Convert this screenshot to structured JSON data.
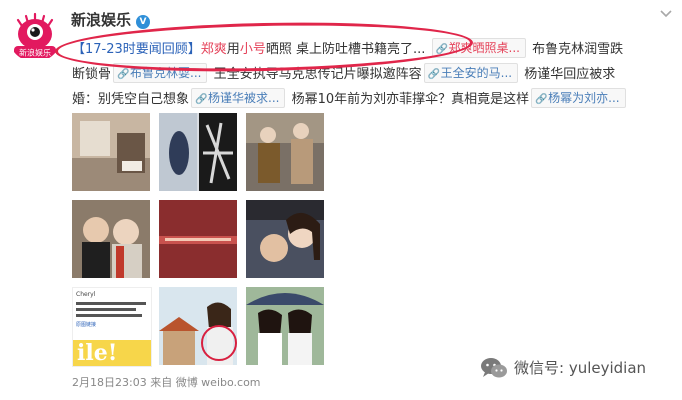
{
  "account": {
    "name": "新浪娱乐",
    "avatar_label": "新浪娱乐",
    "verified_glyph": "V"
  },
  "header_menu_icon": "chevron-down-icon",
  "post": {
    "line1": {
      "bracket": "【17-23时要闻回顾】",
      "name1": "郑爽",
      "text1": "用",
      "name2": "小号",
      "text2": "晒照 桌上防吐槽书籍亮了",
      "ellipsis": "...",
      "tag1": "郑爽晒照桌...",
      "tail": "布鲁克林润雪跌"
    },
    "line2": {
      "text1": "断锁骨",
      "tag2": "布鲁克林耍...",
      "text2": "王全安执导马克思传记片曝拟邀阵容",
      "tag3": "王全安的马...",
      "text3": "杨谨华回应被求"
    },
    "line3": {
      "text1": "婚：别凭空自己想象",
      "tag4": "杨谨华被求...",
      "text2": "杨幂10年前为刘亦菲撑伞？真相竟是这样",
      "tag5": "杨幂为刘亦..."
    }
  },
  "images": [
    {
      "label": "thumb-1"
    },
    {
      "label": "thumb-2"
    },
    {
      "label": "thumb-3"
    },
    {
      "label": "thumb-4"
    },
    {
      "label": "thumb-5"
    },
    {
      "label": "thumb-6"
    },
    {
      "label": "thumb-7"
    },
    {
      "label": "thumb-8"
    },
    {
      "label": "thumb-9"
    }
  ],
  "thumb_text": {
    "sign": "ile!",
    "note_header": "Cheryl",
    "note_link": "原图链接"
  },
  "footer": {
    "time_source": "2月18日23:03 来自 微博 weibo.com"
  },
  "watermark": {
    "text": "微信号: yuleyidian",
    "icon": "wechat-icon"
  },
  "colors": {
    "link_blue": "#4a7eb8",
    "bracket_blue": "#2b62b8",
    "highlight_red": "#e5435a",
    "annotation_red": "#e0264a"
  }
}
